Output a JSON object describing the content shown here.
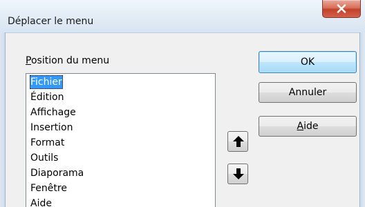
{
  "window": {
    "title": "Déplacer le menu"
  },
  "list": {
    "label_prefix": "",
    "label_mnemonic": "P",
    "label_rest": "osition du menu",
    "items": [
      "Fichier",
      "Édition",
      "Affichage",
      "Insertion",
      "Format",
      "Outils",
      "Diaporama",
      "Fenêtre",
      "Aide"
    ],
    "selected": "Fichier"
  },
  "buttons": {
    "ok": "OK",
    "cancel": "Annuler",
    "help_mnemonic": "A",
    "help_rest": "ide"
  },
  "icons": {
    "close": "close-icon",
    "move_up": "arrow-up-icon",
    "move_down": "arrow-down-icon"
  },
  "colors": {
    "selection": "#3399ff",
    "close_button": "#c2412b"
  }
}
